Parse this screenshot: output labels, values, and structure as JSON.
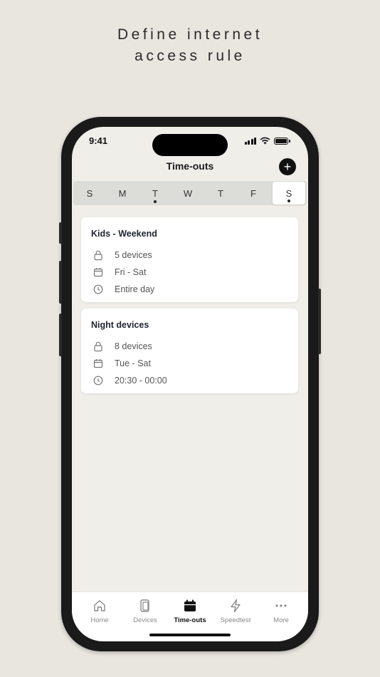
{
  "headline": {
    "line1": "Define internet",
    "line2": "access rule"
  },
  "status_bar": {
    "time": "9:41"
  },
  "header": {
    "title": "Time-outs",
    "add_button": "+"
  },
  "weekdays": [
    {
      "label": "S",
      "dot": false,
      "active": false
    },
    {
      "label": "M",
      "dot": false,
      "active": false
    },
    {
      "label": "T",
      "dot": true,
      "active": false
    },
    {
      "label": "W",
      "dot": false,
      "active": false
    },
    {
      "label": "T",
      "dot": false,
      "active": false
    },
    {
      "label": "F",
      "dot": false,
      "active": false
    },
    {
      "label": "S",
      "dot": true,
      "active": true
    }
  ],
  "rules": [
    {
      "title": "Kids - Weekend",
      "devices": "5 devices",
      "days": "Fri - Sat",
      "time": "Entire day"
    },
    {
      "title": "Night devices",
      "devices": "8 devices",
      "days": "Tue - Sat",
      "time": "20:30 - 00:00"
    }
  ],
  "tabbar": {
    "items": [
      {
        "label": "Home",
        "icon": "home-icon"
      },
      {
        "label": "Devices",
        "icon": "devices-icon"
      },
      {
        "label": "Time-outs",
        "icon": "calendar-icon",
        "active": true
      },
      {
        "label": "Speedtest",
        "icon": "lightning-icon"
      },
      {
        "label": "More",
        "icon": "more-icon"
      }
    ]
  },
  "colors": {
    "background": "#e9e6e0",
    "screen": "#efeee9",
    "accent": "#111111"
  }
}
